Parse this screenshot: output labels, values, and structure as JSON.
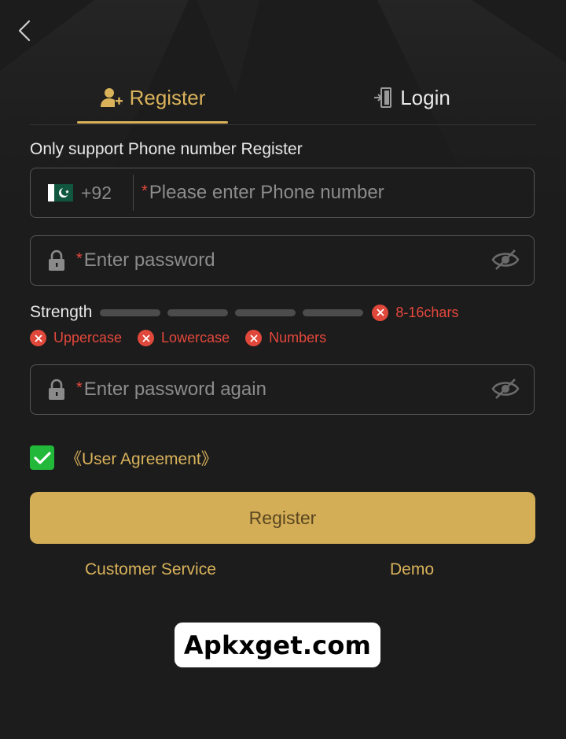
{
  "tabs": {
    "register": "Register",
    "login": "Login"
  },
  "hint": "Only support Phone number Register",
  "phone": {
    "country_code": "+92",
    "required_mark": "*",
    "placeholder": "Please enter Phone number"
  },
  "password": {
    "required_mark": "*",
    "placeholder": "Enter password"
  },
  "password_again": {
    "required_mark": "*",
    "placeholder": "Enter password again"
  },
  "strength": {
    "label": "Strength",
    "requirements": [
      "8-16chars",
      "Uppercase",
      "Lowercase",
      "Numbers"
    ]
  },
  "agreement": {
    "checked": true,
    "label": "《User Agreement》"
  },
  "submit_label": "Register",
  "links": {
    "customer_service": "Customer Service",
    "demo": "Demo"
  },
  "watermark": "Apkxget.com",
  "colors": {
    "accent": "#d9b25a",
    "button": "#d3ae56",
    "error": "#e5483c",
    "check": "#22b83a",
    "background": "#1c1c1c"
  }
}
